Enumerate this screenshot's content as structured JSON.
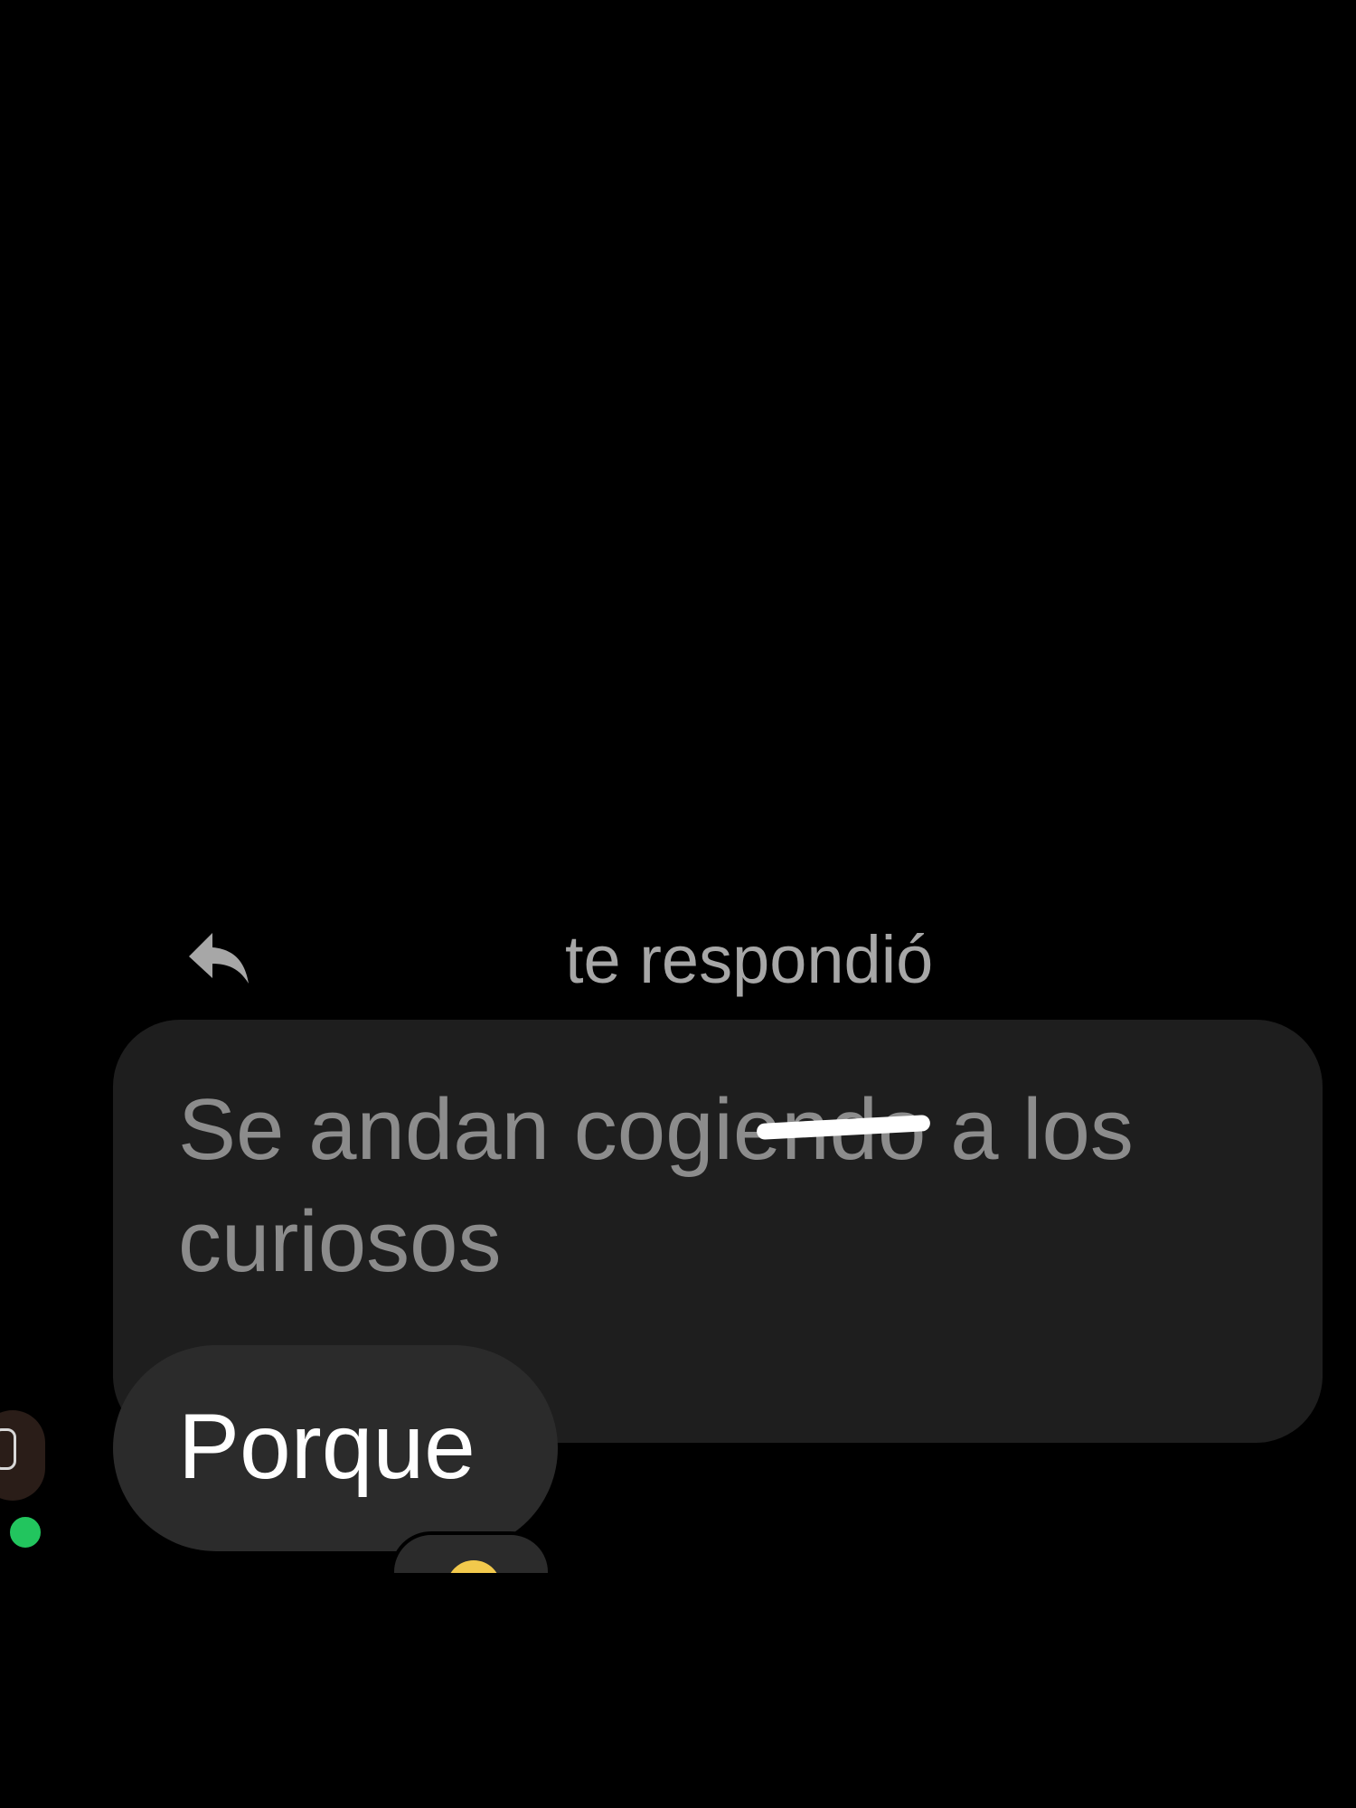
{
  "reply_header": {
    "text": "te respondió",
    "icon": "reply-arrow-icon"
  },
  "quoted_message": {
    "text": "Se andan cogiendo a los curiosos",
    "censored_segment": "ien"
  },
  "message": {
    "text": "Porque"
  },
  "sender": {
    "online": true,
    "status_color": "#22c55e"
  },
  "reaction": {
    "icon": "emoji-reaction-icon"
  },
  "colors": {
    "background": "#000000",
    "quoted_bubble": "#1e1e1e",
    "message_bubble": "#2b2b2b",
    "quoted_text": "#8c8c8c",
    "message_text": "#ffffff"
  }
}
